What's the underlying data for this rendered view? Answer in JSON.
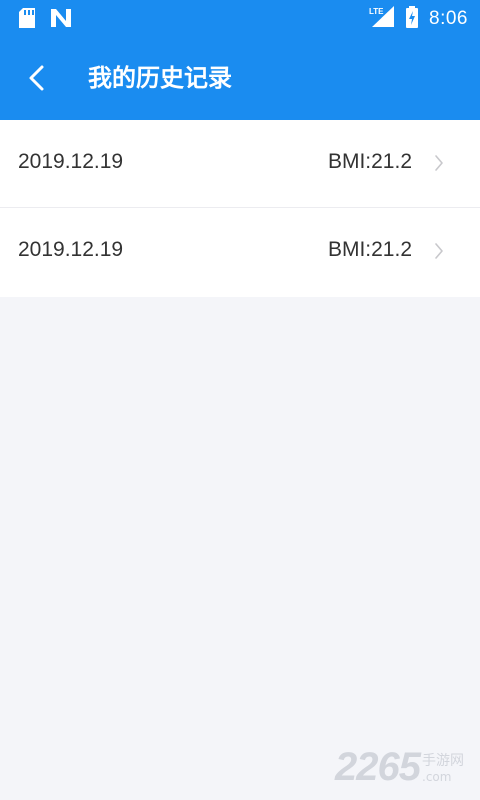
{
  "status_bar": {
    "time": "8:06",
    "network": "LTE",
    "icons": [
      "sd-card-icon",
      "n-notification-icon",
      "signal-icon",
      "battery-charging-icon"
    ]
  },
  "app_bar": {
    "title": "我的历史记录",
    "back_icon": "chevron-left-icon"
  },
  "records": [
    {
      "date": "2019.12.19",
      "bmi": "BMI:21.2"
    },
    {
      "date": "2019.12.19",
      "bmi": "BMI:21.2"
    }
  ],
  "watermark": {
    "number": "2265",
    "suffix": ".com",
    "text": "手游网"
  },
  "colors": {
    "primary": "#1a8cf0",
    "background": "#f4f5f9",
    "text": "#333333"
  }
}
